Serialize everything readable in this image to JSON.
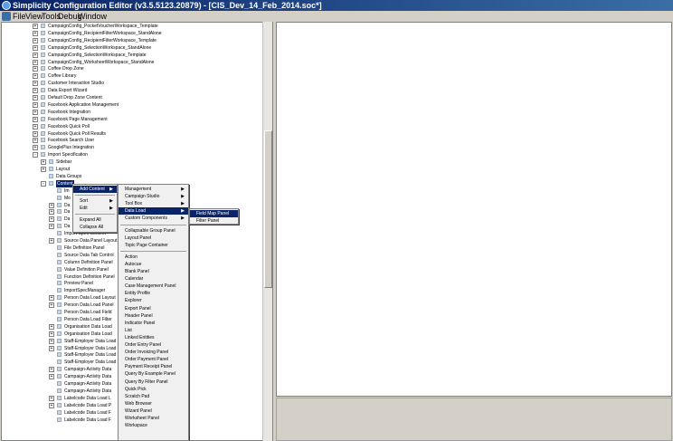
{
  "window": {
    "title": "Simplicity Configuration Editor (v3.5.5123.20879) - [CIS_Dev_14_Feb_2014.soc*]"
  },
  "menubar": [
    "File",
    "View",
    "Tools",
    "Debug",
    "Window"
  ],
  "tree": [
    {
      "label": "CampaignConfig_PocketVoucherWorkspace_Template",
      "expander": "+",
      "level": 1
    },
    {
      "label": "CampaignConfig_RecipientFilterWorkspace_StandAlone",
      "expander": "+",
      "level": 1
    },
    {
      "label": "CampaignConfig_RecipientFilterWorkspace_Template",
      "expander": "+",
      "level": 1
    },
    {
      "label": "CampaignConfig_SelectionWorkspace_StandAlone",
      "expander": "+",
      "level": 1
    },
    {
      "label": "CampaignConfig_SelectionWorkspace_Template",
      "expander": "+",
      "level": 1
    },
    {
      "label": "CampaignConfig_WorksheetWorkspace_StandAlone",
      "expander": "+",
      "level": 1
    },
    {
      "label": "Coffee Drop Zone",
      "expander": "+",
      "level": 1
    },
    {
      "label": "Coffee Library",
      "expander": "+",
      "level": 1
    },
    {
      "label": "Customer Interaction Studio",
      "expander": "+",
      "level": 1
    },
    {
      "label": "Data Export Wizard",
      "expander": "+",
      "level": 1
    },
    {
      "label": "Default Drop Zone Content",
      "expander": "+",
      "level": 1
    },
    {
      "label": "Facebook Application Management",
      "expander": "+",
      "level": 1
    },
    {
      "label": "Facebook Integration",
      "expander": "+",
      "level": 1
    },
    {
      "label": "Facebook Page Management",
      "expander": "+",
      "level": 1
    },
    {
      "label": "Facebook Quick Poll",
      "expander": "+",
      "level": 1
    },
    {
      "label": "Facebook Quick Poll Results",
      "expander": "+",
      "level": 1
    },
    {
      "label": "Facebook Search User",
      "expander": "+",
      "level": 1
    },
    {
      "label": "GooglePlus Integration",
      "expander": "+",
      "level": 1
    },
    {
      "label": "Import Specification",
      "expander": "-",
      "level": 1
    },
    {
      "label": "Sidebar",
      "expander": "+",
      "level": 2
    },
    {
      "label": "Layout",
      "expander": "+",
      "level": 2
    },
    {
      "label": "Data Groups",
      "expander": "",
      "level": 2
    },
    {
      "label": "Content",
      "expander": "-",
      "level": 2,
      "selected": true
    },
    {
      "label": "Im",
      "expander": "",
      "level": 3
    },
    {
      "label": "Mo",
      "expander": "",
      "level": 3
    },
    {
      "label": "Da",
      "expander": "+",
      "level": 3
    },
    {
      "label": "Da",
      "expander": "+",
      "level": 3
    },
    {
      "label": "Da",
      "expander": "+",
      "level": 3
    },
    {
      "label": "Da",
      "expander": "+",
      "level": 3
    },
    {
      "label": "Import Spec Content",
      "expander": "",
      "level": 3
    },
    {
      "label": "Source Data Panel Layout",
      "expander": "+",
      "level": 3
    },
    {
      "label": "File Definition Panel",
      "expander": "",
      "level": 3
    },
    {
      "label": "Source Data Tab Control",
      "expander": "",
      "level": 3
    },
    {
      "label": "Column Definition Panel",
      "expander": "",
      "level": 3
    },
    {
      "label": "Value Definition Panel",
      "expander": "",
      "level": 3
    },
    {
      "label": "Function Definition Panel",
      "expander": "",
      "level": 3
    },
    {
      "label": "Preview Panel",
      "expander": "",
      "level": 3
    },
    {
      "label": "ImportSpecManager",
      "expander": "",
      "level": 3
    },
    {
      "label": "Person Data Load Layout",
      "expander": "+",
      "level": 3
    },
    {
      "label": "Person Data Load Panel",
      "expander": "+",
      "level": 3
    },
    {
      "label": "Person Data Load Field",
      "expander": "",
      "level": 3
    },
    {
      "label": "Person Data Load Filter",
      "expander": "",
      "level": 3
    },
    {
      "label": "Organisation Data Load",
      "expander": "+",
      "level": 3
    },
    {
      "label": "Organisation Data Load",
      "expander": "+",
      "level": 3
    },
    {
      "label": "Staff-Employer Data Load",
      "expander": "+",
      "level": 3
    },
    {
      "label": "Staff-Employer Data Load",
      "expander": "+",
      "level": 3
    },
    {
      "label": "Staff-Employer Data Load",
      "expander": "",
      "level": 3
    },
    {
      "label": "Staff-Employer Data Load",
      "expander": "",
      "level": 3
    },
    {
      "label": "Campaign-Activity Data",
      "expander": "+",
      "level": 3
    },
    {
      "label": "Campaign-Activity Data",
      "expander": "+",
      "level": 3
    },
    {
      "label": "Campaign-Activity Data",
      "expander": "",
      "level": 3
    },
    {
      "label": "Campaign-Activity Data",
      "expander": "",
      "level": 3
    },
    {
      "label": "Labelcode Data Load L",
      "expander": "+",
      "level": 3
    },
    {
      "label": "Labelcode Data Load P",
      "expander": "+",
      "level": 3
    },
    {
      "label": "Labelcode Data Load F",
      "expander": "",
      "level": 3
    },
    {
      "label": "Labelcode Data Load F",
      "expander": "",
      "level": 3
    }
  ],
  "context_menu": [
    {
      "label": "Add Content",
      "submenu": true,
      "highlighted": true
    },
    {
      "sep": true
    },
    {
      "label": "Sort",
      "submenu": true
    },
    {
      "label": "Edit",
      "submenu": true
    },
    {
      "sep": true
    },
    {
      "label": "Expand All"
    },
    {
      "label": "Collapse All"
    }
  ],
  "add_content_menu": [
    {
      "label": "Management",
      "submenu": true
    },
    {
      "label": "Campaign Studio",
      "submenu": true
    },
    {
      "label": "Tool Box",
      "submenu": true
    },
    {
      "label": "Data Load",
      "submenu": true,
      "highlighted": true
    },
    {
      "label": "Custom Components",
      "submenu": true
    },
    {
      "sep": true
    },
    {
      "label": "Collapsable Group Panel"
    },
    {
      "label": "Layout Panel"
    },
    {
      "label": "Topic Page Container"
    },
    {
      "sep": true
    },
    {
      "label": "Action"
    },
    {
      "label": "Autocue"
    },
    {
      "label": "Blank Panel"
    },
    {
      "label": "Calendar"
    },
    {
      "label": "Case Management Panel"
    },
    {
      "label": "Entity Profile"
    },
    {
      "label": "Explorer"
    },
    {
      "label": "Export Panel"
    },
    {
      "label": "Header Panel"
    },
    {
      "label": "Indicator Panel"
    },
    {
      "label": "List"
    },
    {
      "label": "Linked Entities"
    },
    {
      "label": "Order Entry Panel"
    },
    {
      "label": "Order Invoicing Panel"
    },
    {
      "label": "Order Payment Panel"
    },
    {
      "label": "Payment Receipt Panel"
    },
    {
      "label": "Query By Example Panel"
    },
    {
      "label": "Query By Filter Panel"
    },
    {
      "label": "Quick Pick"
    },
    {
      "label": "Scratch Pad"
    },
    {
      "label": "Web Browser"
    },
    {
      "label": "Wizard Panel"
    },
    {
      "label": "Worksheet Panel"
    },
    {
      "label": "Workspace"
    }
  ],
  "data_load_menu": [
    {
      "label": "Field Map Panel",
      "highlighted": true
    },
    {
      "label": "Filter Panel"
    }
  ]
}
